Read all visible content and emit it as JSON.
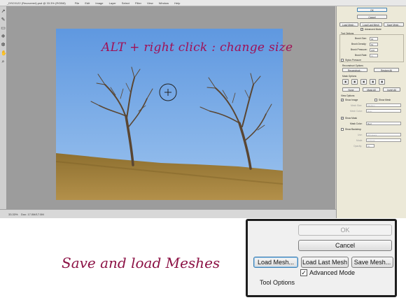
{
  "window": {
    "title": "_DSC0122 (Recovered).psd @ 33.3% (RGB/8)",
    "menu": [
      "File",
      "Edit",
      "Image",
      "Layer",
      "Select",
      "Filter",
      "View",
      "Window",
      "Help"
    ],
    "zoom": "33.33%",
    "status": "Doc: 17.0M/17.0M"
  },
  "toolbar": {
    "tools": [
      "pointer-icon",
      "brush-icon",
      "eraser-icon",
      "freeze-icon",
      "thaw-icon",
      "hand-icon",
      "zoom-icon"
    ]
  },
  "overlay_text": "ALT + right click : change size",
  "caption": "Save and load Meshes",
  "panel": {
    "ok_label": "OK",
    "cancel_label": "Cancel",
    "load_mesh_label": "Load Mesh...",
    "load_last_mesh_label": "Load Last Mesh",
    "save_mesh_label": "Save Mesh...",
    "advanced_mode_label": "Advanced Mode",
    "tool_options_label": "Tool Options",
    "brush_size_label": "Brush Size:",
    "brush_size_value": "84",
    "brush_density_label": "Brush Density:",
    "brush_density_value": "50",
    "brush_pressure_label": "Brush Pressure:",
    "brush_pressure_value": "100",
    "brush_rate_label": "Brush Rate:",
    "brush_rate_value": "80",
    "stylus_pressure_label": "Stylus Pressure",
    "reconstruct_options_label": "Reconstruct Options",
    "reconstruct_label": "Reconstruct...",
    "restore_all_label": "Restore All",
    "mask_options_label": "Mask Options",
    "none_label": "None",
    "mask_all_label": "Mask All",
    "invert_all_label": "Invert All",
    "view_options_label": "View Options",
    "show_image_label": "Show Image",
    "show_mesh_label": "Show Mesh",
    "mesh_size_label": "Mesh Size:",
    "mesh_size_value": "Medium",
    "mesh_color_label": "Mesh Color:",
    "mesh_color_value": "Gray",
    "show_mask_label": "Show Mask",
    "mask_color_label": "Mask Color:",
    "mask_color_value": "Red",
    "show_backdrop_label": "Show Backdrop",
    "use_label": "Use:",
    "use_value": "All Layers",
    "mode_label": "Mode:",
    "mode_value": "In Front",
    "opacity_label": "Opacity:",
    "opacity_value": "50"
  },
  "callout": {
    "ok_label": "OK",
    "cancel_label": "Cancel",
    "load_mesh_label": "Load Mesh...",
    "load_last_mesh_label": "Load Last Mesh",
    "save_mesh_label": "Save Mesh...",
    "advanced_mode_label": "Advanced Mode",
    "advanced_mode_checked": true,
    "tool_options_label": "Tool Options"
  },
  "colors": {
    "accent_text": "#a01056",
    "sky": "#7fb0e6",
    "grass": "#9a7a36",
    "canvas_bg": "#9c9c9c"
  }
}
